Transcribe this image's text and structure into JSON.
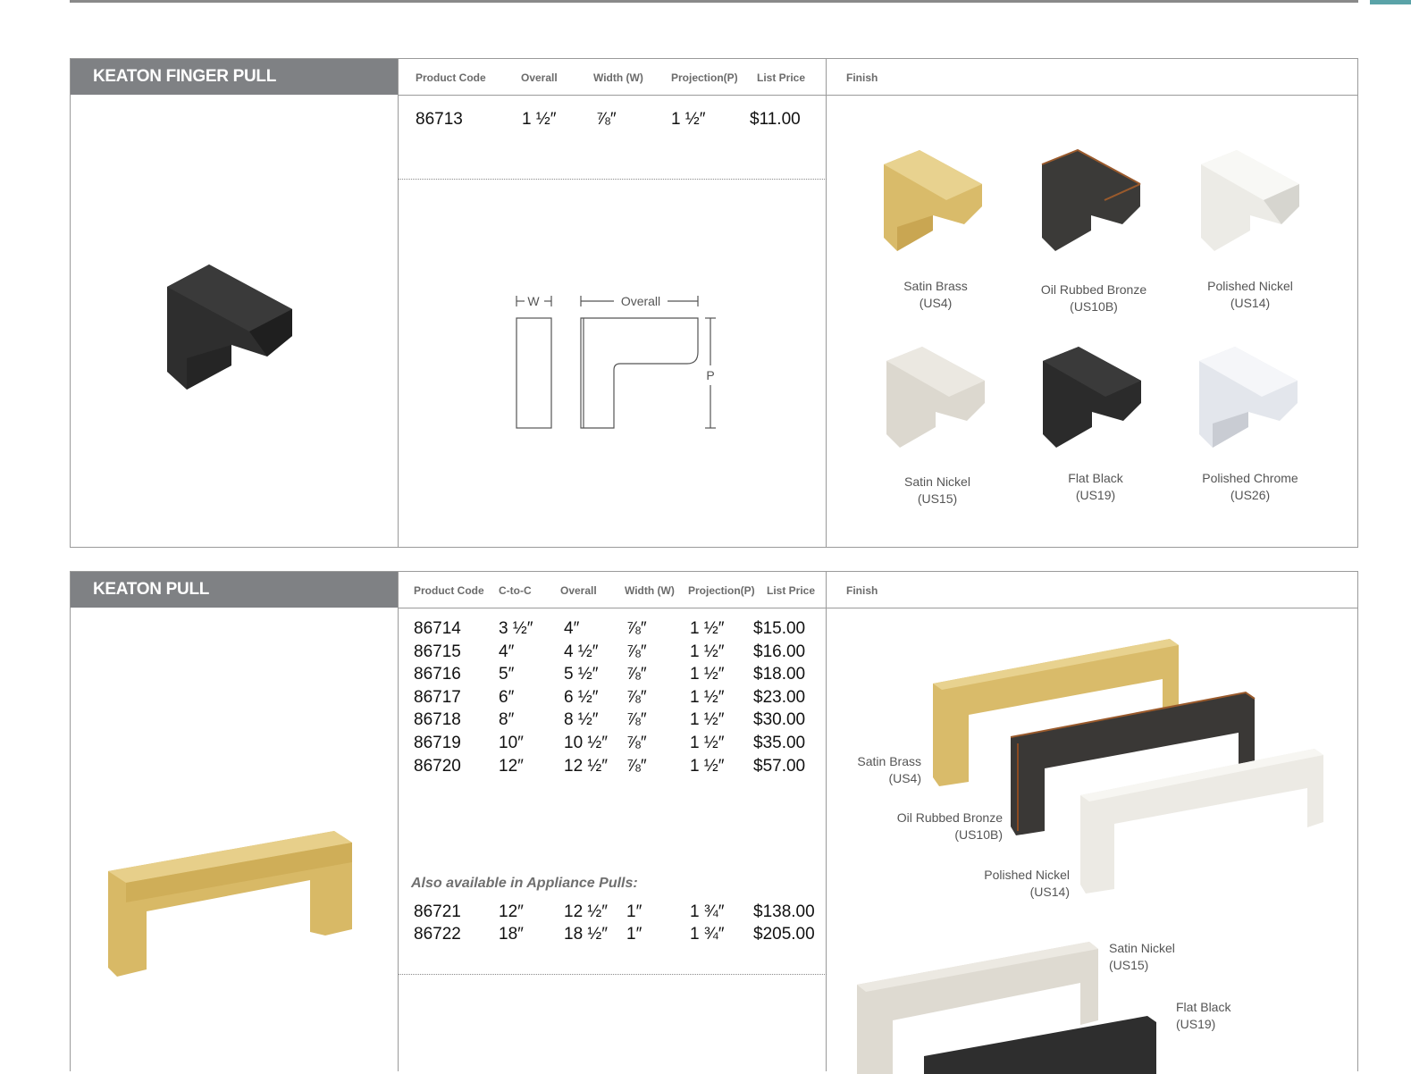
{
  "finger_pull": {
    "title": "KEATON FINGER PULL",
    "headers": [
      "Product Code",
      "Overall",
      "Width (W)",
      "Projection(P)",
      "List Price",
      "Finish"
    ],
    "rows": [
      {
        "code": "86713",
        "overall": "1 ½″",
        "width": "⅞″",
        "projection": "1 ½″",
        "price": "$11.00"
      }
    ],
    "diagram": {
      "w": "W",
      "overall": "Overall",
      "p": "P"
    },
    "finishes": [
      {
        "name": "Satin Brass",
        "code": "(US4)",
        "color": "#d9bb6a"
      },
      {
        "name": "Oil Rubbed Bronze",
        "code": "(US10B)",
        "color": "#3b3a38"
      },
      {
        "name": "Polished Nickel",
        "code": "(US14)",
        "color": "#ecebe6"
      },
      {
        "name": "Satin Nickel",
        "code": "(US15)",
        "color": "#dcd8cf"
      },
      {
        "name": "Flat Black",
        "code": "(US19)",
        "color": "#2b2b2b"
      },
      {
        "name": "Polished Chrome",
        "code": "(US26)",
        "color": "#e3e6ec"
      }
    ]
  },
  "pull": {
    "title": "KEATON PULL",
    "headers": [
      "Product Code",
      "C-to-C",
      "Overall",
      "Width (W)",
      "Projection(P)",
      "List Price",
      "Finish"
    ],
    "rows": [
      {
        "code": "86714",
        "ctoc": "3 ½″",
        "overall": "4″",
        "width": "⅞″",
        "projection": "1 ½″",
        "price": "$15.00"
      },
      {
        "code": "86715",
        "ctoc": "4″",
        "overall": "4 ½″",
        "width": "⅞″",
        "projection": "1 ½″",
        "price": "$16.00"
      },
      {
        "code": "86716",
        "ctoc": "5″",
        "overall": "5 ½″",
        "width": "⅞″",
        "projection": "1 ½″",
        "price": "$18.00"
      },
      {
        "code": "86717",
        "ctoc": "6″",
        "overall": "6 ½″",
        "width": "⅞″",
        "projection": "1 ½″",
        "price": "$23.00"
      },
      {
        "code": "86718",
        "ctoc": "8″",
        "overall": "8 ½″",
        "width": "⅞″",
        "projection": "1 ½″",
        "price": "$30.00"
      },
      {
        "code": "86719",
        "ctoc": "10″",
        "overall": "10 ½″",
        "width": "⅞″",
        "projection": "1 ½″",
        "price": "$35.00"
      },
      {
        "code": "86720",
        "ctoc": "12″",
        "overall": "12 ½″",
        "width": "⅞″",
        "projection": "1 ½″",
        "price": "$57.00"
      }
    ],
    "appliance_note": "Also available in Appliance Pulls:",
    "appliance_rows": [
      {
        "code": "86721",
        "ctoc": "12″",
        "overall": "12 ½″",
        "width": "1″",
        "projection": "1 ¾″",
        "price": "$138.00"
      },
      {
        "code": "86722",
        "ctoc": "18″",
        "overall": "18 ½″",
        "width": "1″",
        "projection": "1 ¾″",
        "price": "$205.00"
      }
    ],
    "finishes": [
      {
        "name": "Satin Brass",
        "code": "(US4)",
        "color": "#d9bb6a"
      },
      {
        "name": "Oil Rubbed Bronze",
        "code": "(US10B)",
        "color": "#3a3836"
      },
      {
        "name": "Polished Nickel",
        "code": "(US14)",
        "color": "#eceae4"
      },
      {
        "name": "Satin Nickel",
        "code": "(US15)",
        "color": "#dedad1"
      },
      {
        "name": "Flat Black",
        "code": "(US19)",
        "color": "#2e2e2e"
      }
    ]
  }
}
